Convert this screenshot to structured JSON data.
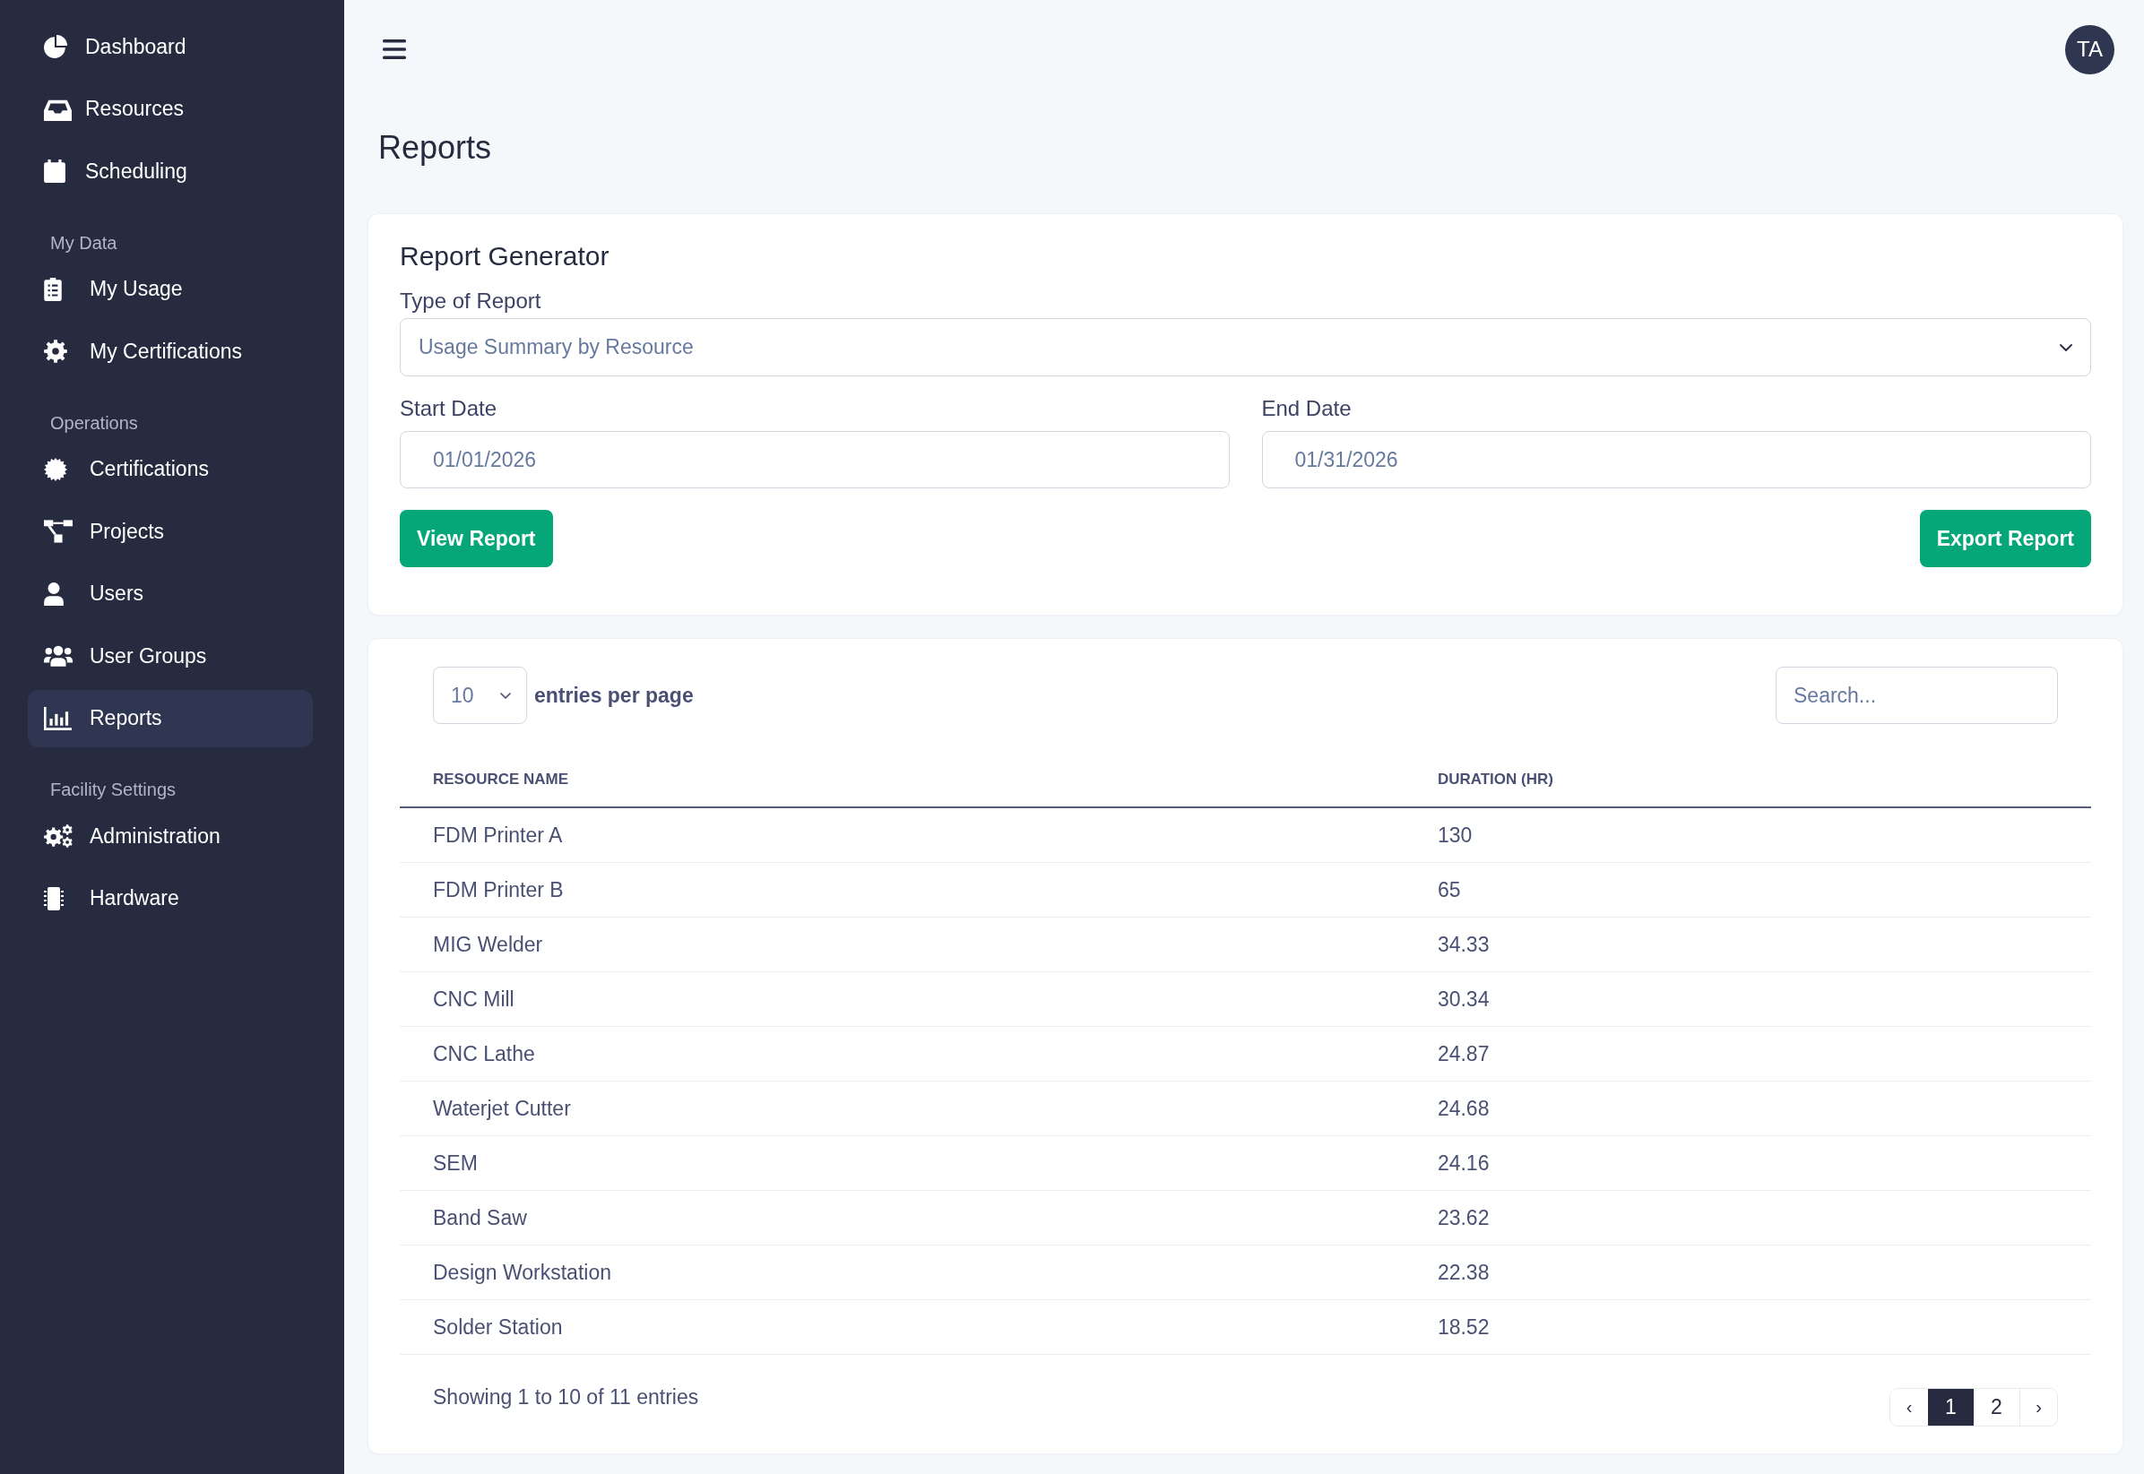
{
  "sidebar": {
    "sections": [
      {
        "items": [
          {
            "label": "Dashboard",
            "selected": false
          },
          {
            "label": "Resources",
            "selected": false
          },
          {
            "label": "Scheduling",
            "selected": false
          }
        ]
      },
      {
        "title": "My Data",
        "items": [
          {
            "label": "My Usage",
            "selected": false
          },
          {
            "label": "My Certifications",
            "selected": false
          }
        ]
      },
      {
        "title": "Operations",
        "items": [
          {
            "label": "Certifications",
            "selected": false
          },
          {
            "label": "Projects",
            "selected": false
          },
          {
            "label": "Users",
            "selected": false
          },
          {
            "label": "User Groups",
            "selected": false
          },
          {
            "label": "Reports",
            "selected": true
          }
        ]
      },
      {
        "title": "Facility Settings",
        "items": [
          {
            "label": "Administration",
            "selected": false
          },
          {
            "label": "Hardware",
            "selected": false
          }
        ]
      }
    ]
  },
  "topbar": {
    "avatar": "TA"
  },
  "page_title": "Reports",
  "report_generator": {
    "title": "Report Generator",
    "report_type": {
      "label": "Type of Report",
      "value": "Usage Summary by Resource"
    },
    "start_date": {
      "label": "Start Date",
      "value": "01/01/2026"
    },
    "end_date": {
      "label": "End Date",
      "value": "01/31/2026"
    },
    "buttons": [
      {
        "label": "View Report"
      },
      {
        "label": "Export Report"
      }
    ]
  },
  "results": {
    "entries_per_page": {
      "value": "10",
      "label": "entries per page"
    },
    "search": {
      "placeholder": "Search..."
    },
    "table": {
      "columns": [
        "RESOURCE NAME",
        "DURATION (HR)"
      ],
      "rows": [
        [
          "FDM Printer A",
          "130"
        ],
        [
          "FDM Printer B",
          "65"
        ],
        [
          "MIG Welder",
          "34.33"
        ],
        [
          "CNC Mill",
          "30.34"
        ],
        [
          "CNC Lathe",
          "24.87"
        ],
        [
          "Waterjet Cutter",
          "24.68"
        ],
        [
          "SEM",
          "24.16"
        ],
        [
          "Band Saw",
          "23.62"
        ],
        [
          "Design Workstation",
          "22.38"
        ],
        [
          "Solder Station",
          "18.52"
        ]
      ]
    },
    "summary": "Showing 1 to 10 of 11 entries",
    "pagination": {
      "previous": "‹",
      "pages": [
        {
          "label": "1",
          "selected": true
        },
        {
          "label": "2",
          "selected": false
        }
      ],
      "next": "›"
    }
  }
}
